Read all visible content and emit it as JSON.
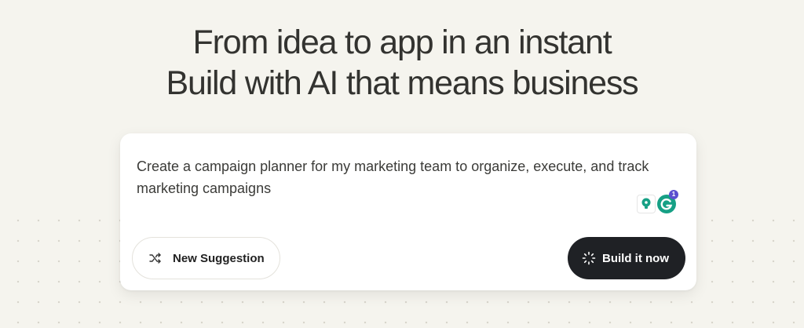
{
  "hero": {
    "line1": "From idea to app in an instant",
    "line2": "Build with AI that means business"
  },
  "prompt_box": {
    "text": "Create a campaign planner for my marketing team to organize, execute, and track marketing campaigns"
  },
  "extensions": {
    "grammarly_badge_count": "1"
  },
  "actions": {
    "suggestion_label": "New Suggestion",
    "build_label": "Build it now"
  },
  "icons": {
    "suggestion": "shuffle-icon",
    "build": "loading-spinner-icon",
    "bulb": "lightbulb-icon",
    "grammarly": "grammarly-icon"
  },
  "colors": {
    "background": "#f5f4ee",
    "primary_button": "#1f2125",
    "grammarly": "#16a085"
  }
}
